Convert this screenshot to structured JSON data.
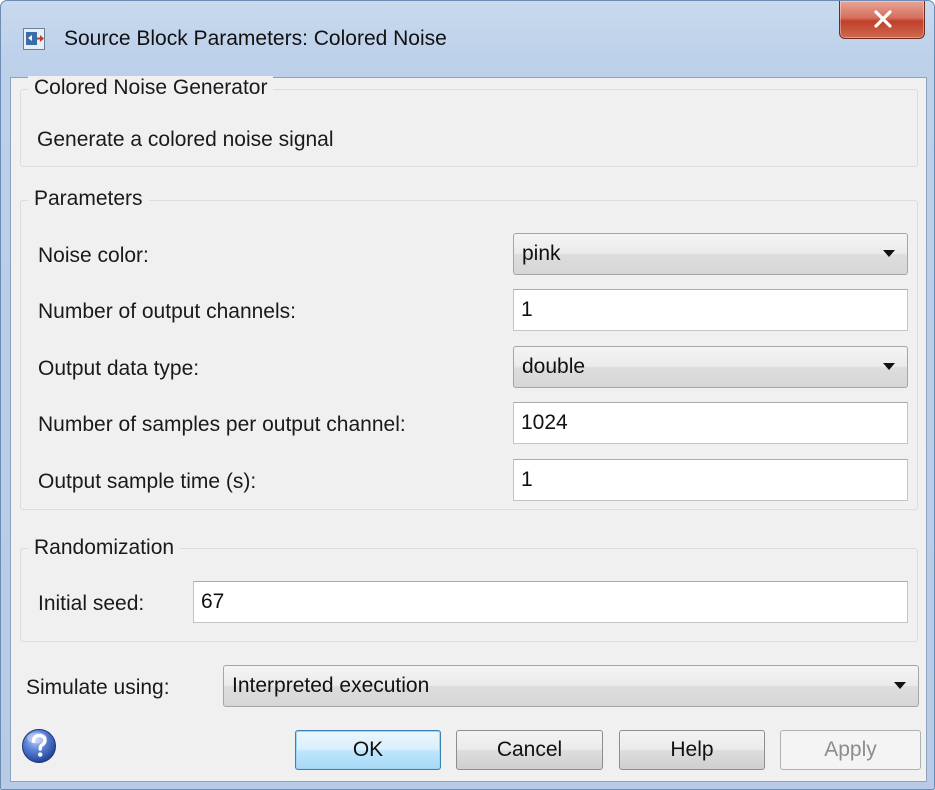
{
  "window": {
    "title": "Source Block Parameters: Colored Noise",
    "app_icon": "simulink-block-icon",
    "close_icon": "close-icon"
  },
  "description_group": {
    "legend": "Colored Noise Generator",
    "text": "Generate a colored noise signal"
  },
  "parameters_group": {
    "legend": "Parameters",
    "noise_color": {
      "label": "Noise color:",
      "value": "pink"
    },
    "output_channels": {
      "label": "Number of output channels:",
      "value": "1"
    },
    "output_data_type": {
      "label": "Output data type:",
      "value": "double"
    },
    "samples_per_channel": {
      "label": "Number of samples per output channel:",
      "value": "1024"
    },
    "sample_time": {
      "label": "Output sample time (s):",
      "value": "1"
    }
  },
  "randomization_group": {
    "legend": "Randomization",
    "initial_seed": {
      "label": "Initial seed:",
      "value": "67"
    }
  },
  "simulate": {
    "label": "Simulate using:",
    "value": "Interpreted execution"
  },
  "buttons": {
    "help_icon": "help-icon",
    "ok": "OK",
    "cancel": "Cancel",
    "help": "Help",
    "apply": "Apply"
  }
}
